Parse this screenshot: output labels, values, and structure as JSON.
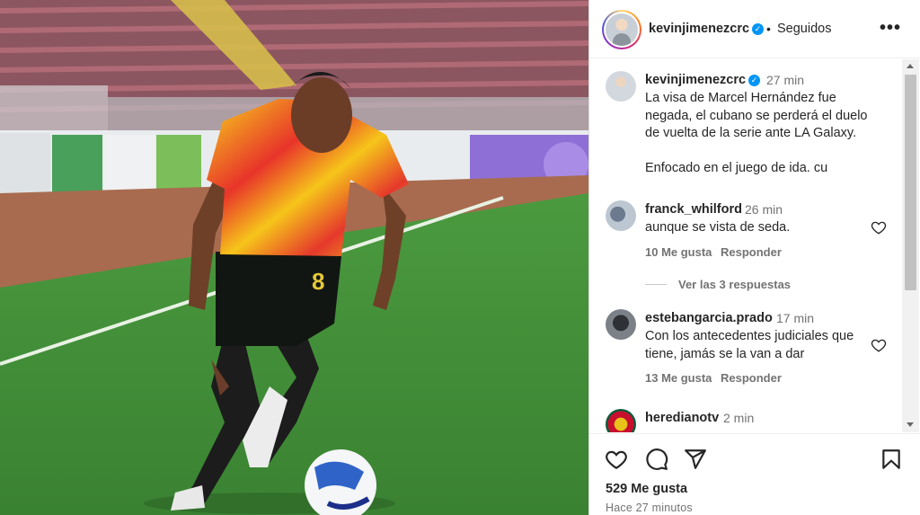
{
  "post": {
    "author": "kevinjimenezcrc",
    "follow_status": "Seguidos",
    "separator": "•",
    "more_label": "•••",
    "verified_mark": "✓",
    "caption": {
      "time": "27 min",
      "line1": "La visa de Marcel Hernández fue",
      "line2": "negada, el cubano se perderá el duelo",
      "line3": "de vuelta de la serie ante LA Galaxy.",
      "line4": "Enfocado en el juego de ida. cu"
    },
    "likes": "529 Me gusta",
    "posted_ago": "Hace 27 minutos"
  },
  "comments": [
    {
      "user": "franck_whilford",
      "time": "26 min",
      "text": "aunque se vista de seda.",
      "likes": "10 Me gusta",
      "reply": "Responder",
      "view_replies": "Ver las 3 respuestas"
    },
    {
      "user": "estebangarcia.prado",
      "time": "17 min",
      "line1": "Con los antecedentes judiciales que",
      "line2": "tiene, jamás se la van a dar",
      "likes": "13 Me gusta",
      "reply": "Responder"
    },
    {
      "user": "herediano­tv",
      "time": "2 min"
    }
  ],
  "icons": {
    "like": "heart-icon",
    "comment": "comment-icon",
    "share": "share-icon",
    "save": "bookmark-icon",
    "more": "more-options-icon"
  },
  "colors": {
    "verified": "#0095f6",
    "jersey_red": "#e3342b",
    "jersey_yellow": "#f6d21b",
    "pitch": "#3f8a36"
  }
}
